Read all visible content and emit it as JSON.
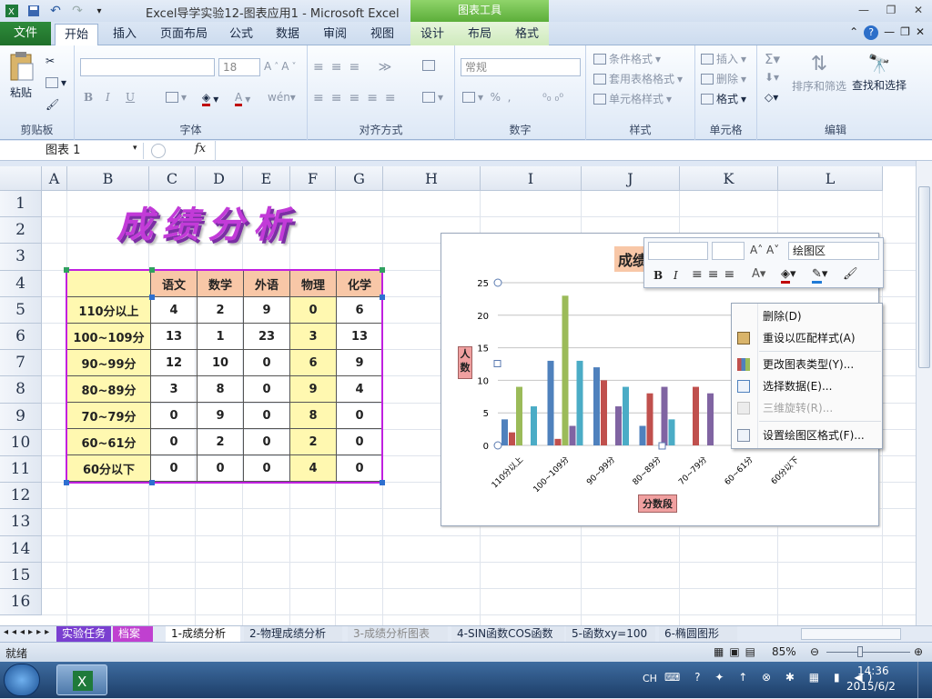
{
  "window": {
    "title": "Excel导学实验12-图表应用1  -  Microsoft Excel",
    "context_tab_group": "图表工具"
  },
  "tabs": [
    "文件",
    "开始",
    "插入",
    "页面布局",
    "公式",
    "数据",
    "审阅",
    "视图",
    "设计",
    "布局",
    "格式"
  ],
  "ribbon": {
    "clipboard": {
      "label": "剪贴板",
      "paste": "粘贴"
    },
    "font": {
      "label": "字体",
      "size": "18",
      "bold": "B",
      "italic": "I",
      "underline": "U"
    },
    "alignment": {
      "label": "对齐方式"
    },
    "number": {
      "label": "数字",
      "format": "常规"
    },
    "styles": {
      "label": "样式",
      "cond": "条件格式",
      "table": "套用表格格式",
      "cell": "单元格样式"
    },
    "cells": {
      "label": "单元格",
      "insert": "插入",
      "delete": "删除",
      "format": "格式"
    },
    "editing": {
      "label": "编辑",
      "sort": "排序和筛选",
      "find": "查找和选择"
    }
  },
  "formula_bar": {
    "name_box": "图表  1",
    "fx": "fx"
  },
  "columns": [
    "A",
    "B",
    "C",
    "D",
    "E",
    "F",
    "G",
    "H",
    "I",
    "J",
    "K",
    "L"
  ],
  "rows": [
    "1",
    "2",
    "3",
    "4",
    "5",
    "6",
    "7",
    "8",
    "9",
    "10",
    "11",
    "12",
    "13",
    "14",
    "15",
    "16"
  ],
  "sheet_title": "成绩分析",
  "table": {
    "headers": [
      "语文",
      "数学",
      "外语",
      "物理",
      "化学"
    ],
    "rows": [
      {
        "label": "110分以上",
        "values": [
          "4",
          "2",
          "9",
          "0",
          "6"
        ]
      },
      {
        "label": "100~109分",
        "values": [
          "13",
          "1",
          "23",
          "3",
          "13"
        ]
      },
      {
        "label": "90~99分",
        "values": [
          "12",
          "10",
          "0",
          "6",
          "9"
        ]
      },
      {
        "label": "80~89分",
        "values": [
          "3",
          "8",
          "0",
          "9",
          "4"
        ]
      },
      {
        "label": "70~79分",
        "values": [
          "0",
          "9",
          "0",
          "8",
          "0"
        ]
      },
      {
        "label": "60~61分",
        "values": [
          "0",
          "2",
          "0",
          "2",
          "0"
        ]
      },
      {
        "label": "60分以下",
        "values": [
          "0",
          "0",
          "0",
          "4",
          "0"
        ]
      }
    ]
  },
  "chart_data": {
    "type": "bar",
    "title": "成绩",
    "xlabel": "分数段",
    "ylabel": "人数",
    "ylim": [
      0,
      25
    ],
    "yticks": [
      "0",
      "5",
      "10",
      "15",
      "20",
      "25"
    ],
    "categories": [
      "110分以上",
      "100~109分",
      "90~99分",
      "80~89分",
      "70~79分",
      "60~61分",
      "60分以下"
    ],
    "series": [
      {
        "name": "语文",
        "color": "#4f81bd",
        "values": [
          4,
          13,
          12,
          3,
          0,
          0,
          0
        ]
      },
      {
        "name": "数学",
        "color": "#c0504d",
        "values": [
          2,
          1,
          10,
          8,
          9,
          2,
          0
        ]
      },
      {
        "name": "外语",
        "color": "#9bbb59",
        "values": [
          9,
          23,
          0,
          0,
          0,
          0,
          0
        ]
      },
      {
        "name": "物理",
        "color": "#8064a2",
        "values": [
          0,
          3,
          6,
          9,
          8,
          2,
          4
        ]
      },
      {
        "name": "化学",
        "color": "#4bacc6",
        "values": [
          6,
          13,
          9,
          4,
          0,
          0,
          0
        ]
      }
    ],
    "grid": true
  },
  "mini_toolbar": {
    "element": "绘图区",
    "bold": "B",
    "italic": "I"
  },
  "context_menu": [
    {
      "label": "删除(D)",
      "disabled": false
    },
    {
      "label": "重设以匹配样式(A)",
      "disabled": false
    },
    {
      "label": "更改图表类型(Y)...",
      "disabled": false
    },
    {
      "label": "选择数据(E)...",
      "disabled": false
    },
    {
      "label": "三维旋转(R)...",
      "disabled": true
    },
    {
      "label": "设置绘图区格式(F)...",
      "disabled": false
    }
  ],
  "sheet_tabs": [
    "实验任务",
    "档案",
    "1-成绩分析",
    "2-物理成绩分析",
    "3-成绩分析图表",
    "4-SIN函数COS函数",
    "5-函数xy=100",
    "6-椭圆图形"
  ],
  "status": {
    "ready": "就绪",
    "zoom": "85%"
  },
  "taskbar": {
    "lang": "CH",
    "time": "14:36",
    "date": "2015/6/2"
  }
}
